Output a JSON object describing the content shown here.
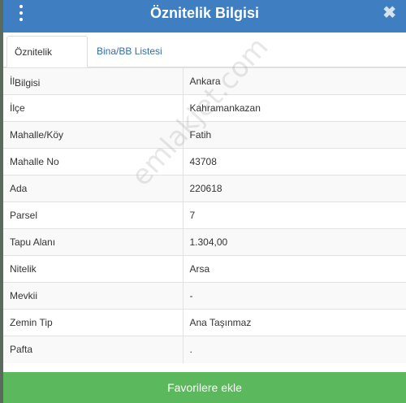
{
  "header": {
    "title": "Öznitelik Bilgisi",
    "menu_icon": "vertical-dots-icon",
    "close_icon": "close-icon",
    "close_glyph": "✖",
    "color": "#3f7fc1"
  },
  "tabs": [
    {
      "label": "Öznitelik Bilgisi",
      "active": true
    },
    {
      "label": "Bina/BB Listesi",
      "active": false
    }
  ],
  "rows": [
    {
      "key": "İl",
      "value": "Ankara"
    },
    {
      "key": "İlçe",
      "value": "Kahramankazan"
    },
    {
      "key": "Mahalle/Köy",
      "value": "Fatih"
    },
    {
      "key": "Mahalle No",
      "value": "43708"
    },
    {
      "key": "Ada",
      "value": "220618"
    },
    {
      "key": "Parsel",
      "value": "7"
    },
    {
      "key": "Tapu Alanı",
      "value": "1.304,00"
    },
    {
      "key": "Nitelik",
      "value": "Arsa"
    },
    {
      "key": "Mevkii",
      "value": "-"
    },
    {
      "key": "Zemin Tip",
      "value": "Ana Taşınmaz"
    },
    {
      "key": "Pafta",
      "value": "."
    }
  ],
  "watermark": "emlakjet.com",
  "footer": {
    "label": "Favorilere ekle",
    "color": "#5cb85c"
  }
}
